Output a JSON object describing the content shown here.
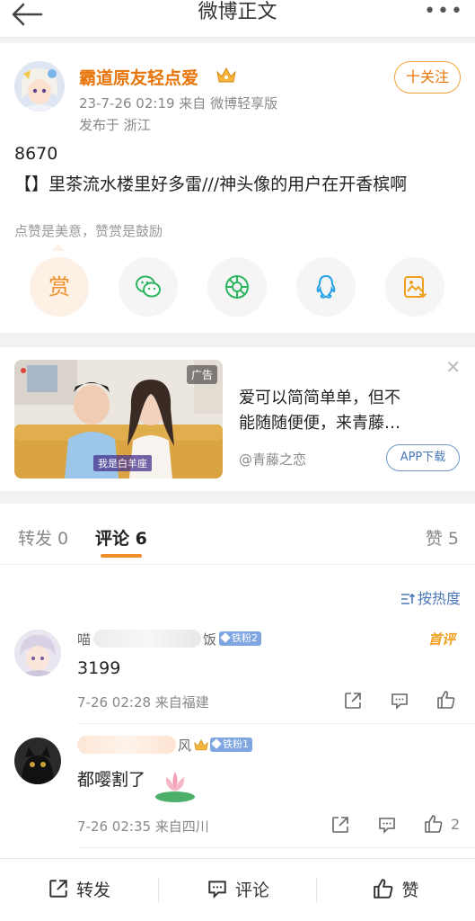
{
  "topbar": {
    "title": "微博正文"
  },
  "post": {
    "author": "霸道原友轻点爱",
    "meta": "23-7-26 02:19  来自 微博轻享版",
    "location": "发布于 浙江",
    "follow_label": "十关注",
    "text_line1": "8670",
    "text_line2": "【】里茶流水楼里好多雷///神头像的用户在开香槟啊",
    "tip": "点赞是美意，赞赏是鼓励",
    "share_buttons": [
      {
        "icon": "reward-icon",
        "glyph": "赏"
      },
      {
        "icon": "wechat-icon"
      },
      {
        "icon": "moments-icon"
      },
      {
        "icon": "qq-icon"
      },
      {
        "icon": "save-image-icon"
      }
    ]
  },
  "ad": {
    "tag": "广告",
    "caption": "我是白羊座",
    "line1": "爱可以简简单单，但不",
    "line2": "能随随便便，来青藤…",
    "source": "@青藤之恋",
    "button": "APP下载"
  },
  "tabs": {
    "repost": "转发 0",
    "comment": "评论 6",
    "like": "赞 5"
  },
  "comments": {
    "sort_label": "按热度",
    "items": [
      {
        "name_visible_start": "喵",
        "name_visible_end": "饭",
        "badge": "铁粉2",
        "text": "3199",
        "meta": "7-26 02:28  来自福建",
        "hot": "首评",
        "likes": ""
      },
      {
        "name_visible_end": "风",
        "badge": "铁粉1",
        "text": "都嘤割了",
        "meta": "7-26 02:35  来自四川",
        "likes": "2"
      }
    ]
  },
  "bottombar": {
    "repost": "转发",
    "comment": "评论",
    "like": "赞"
  },
  "colors": {
    "accent_orange": "#e8750a",
    "link_blue": "#4a78b8",
    "badge_blue": "#7fa6e0"
  }
}
